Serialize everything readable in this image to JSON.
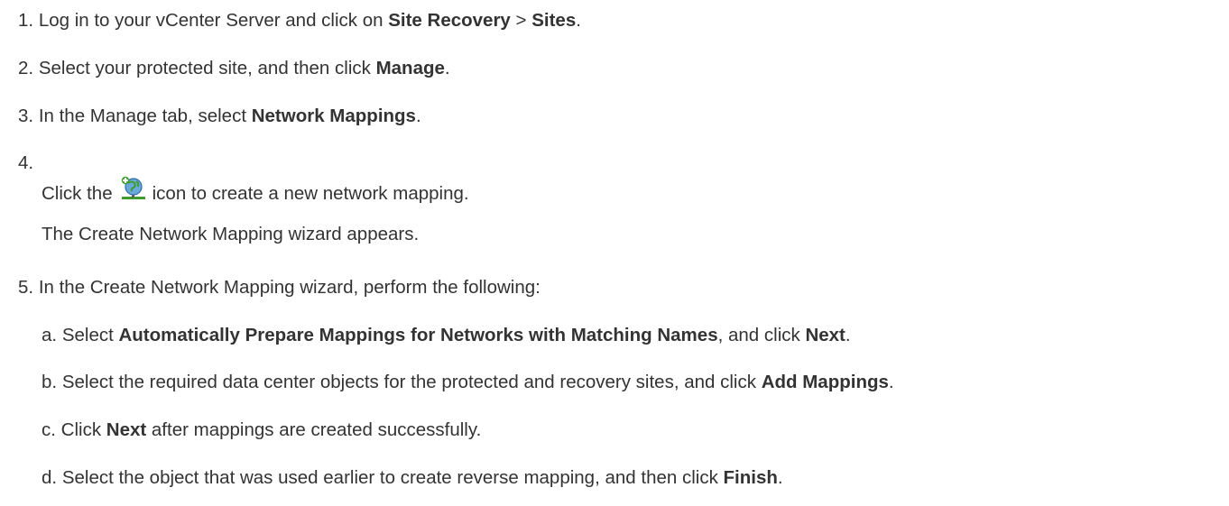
{
  "steps": [
    {
      "num": "1.",
      "parts": [
        "Log in to your vCenter Server and click on ",
        "Site Recovery",
        " > ",
        "Sites",
        "."
      ]
    },
    {
      "num": "2.",
      "parts": [
        "Select your protected site, and then click ",
        "Manage",
        "."
      ]
    },
    {
      "num": "3.",
      "parts": [
        "In the Manage tab, select ",
        "Network Mappings",
        "."
      ]
    },
    {
      "num": "4.",
      "line1_before": "Click the",
      "icon": "network-mapping-add-icon",
      "line1_after": "icon to create a new network mapping.",
      "line2": "The Create Network Mapping wizard appears."
    },
    {
      "num": "5.",
      "text": "In the Create Network Mapping wizard, perform the following:",
      "substeps": [
        {
          "letter": "a.",
          "parts": [
            "Select ",
            "Automatically Prepare Mappings for Networks with Matching Names",
            ", and click ",
            "Next",
            "."
          ]
        },
        {
          "letter": "b.",
          "parts": [
            "Select the required data center objects for the protected and recovery sites, and click ",
            "Add Mappings",
            "."
          ]
        },
        {
          "letter": "c.",
          "parts": [
            "Click ",
            "Next",
            " after mappings are created successfully."
          ]
        },
        {
          "letter": "d.",
          "parts": [
            "Select the object that was used earlier to create reverse mapping, and then click ",
            "Finish",
            "."
          ]
        }
      ]
    }
  ],
  "colors": {
    "text": "#333333",
    "background": "#ffffff"
  }
}
